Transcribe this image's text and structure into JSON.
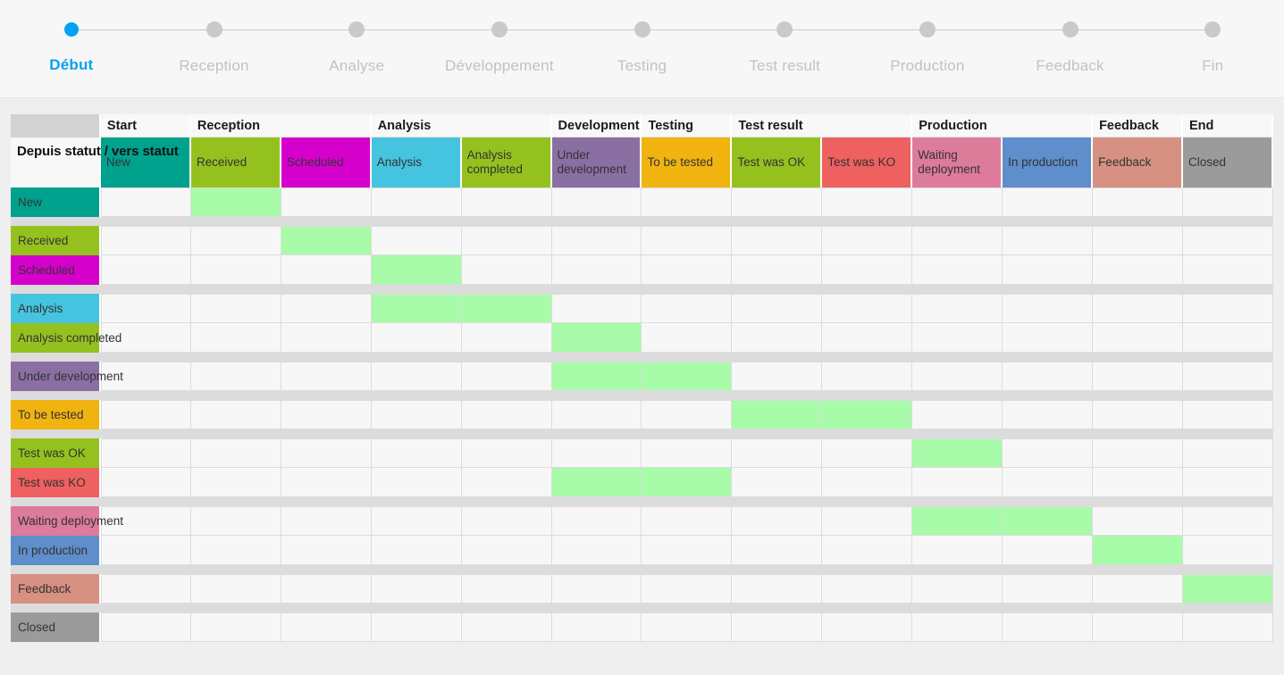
{
  "stepper": {
    "steps": [
      {
        "label": "Début",
        "active": true
      },
      {
        "label": "Reception",
        "active": false
      },
      {
        "label": "Analyse",
        "active": false
      },
      {
        "label": "Développement",
        "active": false
      },
      {
        "label": "Testing",
        "active": false
      },
      {
        "label": "Test result",
        "active": false
      },
      {
        "label": "Production",
        "active": false
      },
      {
        "label": "Feedback",
        "active": false
      },
      {
        "label": "Fin",
        "active": false
      }
    ],
    "active_color": "#02a2f2",
    "inactive_color": "#c2c2c2"
  },
  "matrix": {
    "corner_label": "Depuis statut / vers statut",
    "sort_icon": "sort-arrow-icon",
    "column_groups": [
      {
        "label": "Start",
        "span": 1
      },
      {
        "label": "Reception",
        "span": 2
      },
      {
        "label": "Analysis",
        "span": 2
      },
      {
        "label": "Development",
        "span": 1
      },
      {
        "label": "Testing",
        "span": 1
      },
      {
        "label": "Test result",
        "span": 2
      },
      {
        "label": "Production",
        "span": 2
      },
      {
        "label": "Feedback",
        "span": 1
      },
      {
        "label": "End",
        "span": 1
      }
    ],
    "columns": [
      {
        "label": "New",
        "color": "#00a28e"
      },
      {
        "label": "Received",
        "color": "#95c11f"
      },
      {
        "label": "Scheduled",
        "color": "#d600cc"
      },
      {
        "label": "Analysis",
        "color": "#44c4df"
      },
      {
        "label": "Analysis completed",
        "color": "#95c11f"
      },
      {
        "label": "Under development",
        "color": "#8a6fa3"
      },
      {
        "label": "To be tested",
        "color": "#f0b310"
      },
      {
        "label": "Test was OK",
        "color": "#95c11f"
      },
      {
        "label": "Test was KO",
        "color": "#ef6060"
      },
      {
        "label": "Waiting deployment",
        "color": "#dd7b9b"
      },
      {
        "label": "In production",
        "color": "#5e8ecb"
      },
      {
        "label": "Feedback",
        "color": "#d69182"
      },
      {
        "label": "Closed",
        "color": "#9b9b9b"
      }
    ],
    "rows": [
      {
        "label": "New",
        "color": "#00a28e",
        "group_start": true,
        "transitions": [
          0,
          1,
          0,
          0,
          0,
          0,
          0,
          0,
          0,
          0,
          0,
          0,
          0
        ]
      },
      {
        "label": "Received",
        "color": "#95c11f",
        "group_start": true,
        "transitions": [
          0,
          0,
          1,
          0,
          0,
          0,
          0,
          0,
          0,
          0,
          0,
          0,
          0
        ]
      },
      {
        "label": "Scheduled",
        "color": "#d600cc",
        "group_start": false,
        "transitions": [
          0,
          0,
          0,
          1,
          0,
          0,
          0,
          0,
          0,
          0,
          0,
          0,
          0
        ]
      },
      {
        "label": "Analysis",
        "color": "#44c4df",
        "group_start": true,
        "transitions": [
          0,
          0,
          0,
          1,
          1,
          0,
          0,
          0,
          0,
          0,
          0,
          0,
          0
        ]
      },
      {
        "label": "Analysis completed",
        "color": "#95c11f",
        "group_start": false,
        "transitions": [
          0,
          0,
          0,
          0,
          0,
          1,
          0,
          0,
          0,
          0,
          0,
          0,
          0
        ]
      },
      {
        "label": "Under development",
        "color": "#8a6fa3",
        "group_start": true,
        "transitions": [
          0,
          0,
          0,
          0,
          0,
          1,
          1,
          0,
          0,
          0,
          0,
          0,
          0
        ]
      },
      {
        "label": "To be tested",
        "color": "#f0b310",
        "group_start": true,
        "transitions": [
          0,
          0,
          0,
          0,
          0,
          0,
          0,
          1,
          1,
          0,
          0,
          0,
          0
        ]
      },
      {
        "label": "Test was OK",
        "color": "#95c11f",
        "group_start": true,
        "transitions": [
          0,
          0,
          0,
          0,
          0,
          0,
          0,
          0,
          0,
          1,
          0,
          0,
          0
        ]
      },
      {
        "label": "Test was KO",
        "color": "#ef6060",
        "group_start": false,
        "transitions": [
          0,
          0,
          0,
          0,
          0,
          1,
          1,
          0,
          0,
          0,
          0,
          0,
          0
        ]
      },
      {
        "label": "Waiting deployment",
        "color": "#dd7b9b",
        "group_start": true,
        "transitions": [
          0,
          0,
          0,
          0,
          0,
          0,
          0,
          0,
          0,
          1,
          1,
          0,
          0
        ]
      },
      {
        "label": "In production",
        "color": "#5e8ecb",
        "group_start": false,
        "transitions": [
          0,
          0,
          0,
          0,
          0,
          0,
          0,
          0,
          0,
          0,
          0,
          1,
          0
        ]
      },
      {
        "label": "Feedback",
        "color": "#d69182",
        "group_start": true,
        "transitions": [
          0,
          0,
          0,
          0,
          0,
          0,
          0,
          0,
          0,
          0,
          0,
          0,
          1
        ]
      },
      {
        "label": "Closed",
        "color": "#9b9b9b",
        "group_start": true,
        "transitions": [
          0,
          0,
          0,
          0,
          0,
          0,
          0,
          0,
          0,
          0,
          0,
          0,
          0
        ]
      }
    ],
    "highlight_color": "#a8fba8",
    "empty_color": "#f7f7f7",
    "spacer_color": "#dcdcdc"
  }
}
